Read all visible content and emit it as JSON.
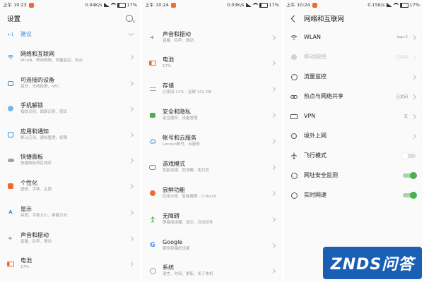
{
  "status_bars": [
    {
      "time": "上午 10:23",
      "speed": "0.04K/s",
      "battery": "17%"
    },
    {
      "time": "上午 10:24",
      "speed": "0.03K/s",
      "battery": "17%"
    },
    {
      "time": "上午 10:24",
      "speed": "0.15K/s",
      "battery": "17%"
    }
  ],
  "panel1": {
    "title": "设置",
    "suggest": {
      "prefix": "+1",
      "label": "建议"
    },
    "items": [
      {
        "label": "网络和互联网",
        "sub": "WLAN、移动网络、流量监控、热点"
      },
      {
        "label": "可连接的设备",
        "sub": "蓝牙、无线投屏、NFC"
      },
      {
        "label": "手机解锁",
        "sub": "指纹识别、面部识别、密码"
      },
      {
        "label": "应用和通知",
        "sub": "默认应用、通知管理、权限"
      },
      {
        "label": "快捷面板",
        "sub": "快捷面板项目排序"
      },
      {
        "label": "个性化",
        "sub": "壁纸、字体、主题"
      },
      {
        "label": "显示",
        "sub": "亮度、字体大小、屏幕方向"
      },
      {
        "label": "声音和振动",
        "sub": "音量、铃声、振动"
      },
      {
        "label": "电池",
        "sub": "17%"
      }
    ]
  },
  "panel2": {
    "items": [
      {
        "label": "声音和振动",
        "sub": "音量、铃声、振动"
      },
      {
        "label": "电池",
        "sub": "17%"
      },
      {
        "label": "存储",
        "sub": "已使用 21% - 还剩 101 GB"
      },
      {
        "label": "安全和隐私",
        "sub": "定位服务、设备管理"
      },
      {
        "label": "帐号和云服务",
        "sub": "Lenovo帐号、云服务"
      },
      {
        "label": "游戏模式",
        "sub": "性能加速、防误触、免打扰"
      },
      {
        "label": "尝鲜功能",
        "sub": "应用分身、智能截屏、U-Touch"
      },
      {
        "label": "无障碍",
        "sub": "屏幕阅读器、显示、互动控件"
      },
      {
        "label": "Google",
        "sub": "服务和偏好设置"
      },
      {
        "label": "系统",
        "sub": "语言、时间、更新、关于本机"
      }
    ]
  },
  "panel3": {
    "title": "网络和互联网",
    "items": [
      {
        "label": "WLAN",
        "value": "xxp-2"
      },
      {
        "label": "移动网络",
        "value": "已关闭"
      },
      {
        "label": "流量监控",
        "value": ""
      },
      {
        "label": "热点与网络共享",
        "value": "已关闭"
      },
      {
        "label": "VPN",
        "value": "无"
      },
      {
        "label": "境外上网",
        "value": ""
      },
      {
        "label": "飞行模式",
        "toggle": false
      },
      {
        "label": "网址安全监测",
        "toggle": true
      },
      {
        "label": "实时网速",
        "toggle": true
      }
    ]
  },
  "watermark": "ZNDS问答",
  "colors": {
    "accent_blue": "#3a8fd9",
    "toggle_on": "#4caf50",
    "watermark_bg": "#1a5fb4"
  }
}
